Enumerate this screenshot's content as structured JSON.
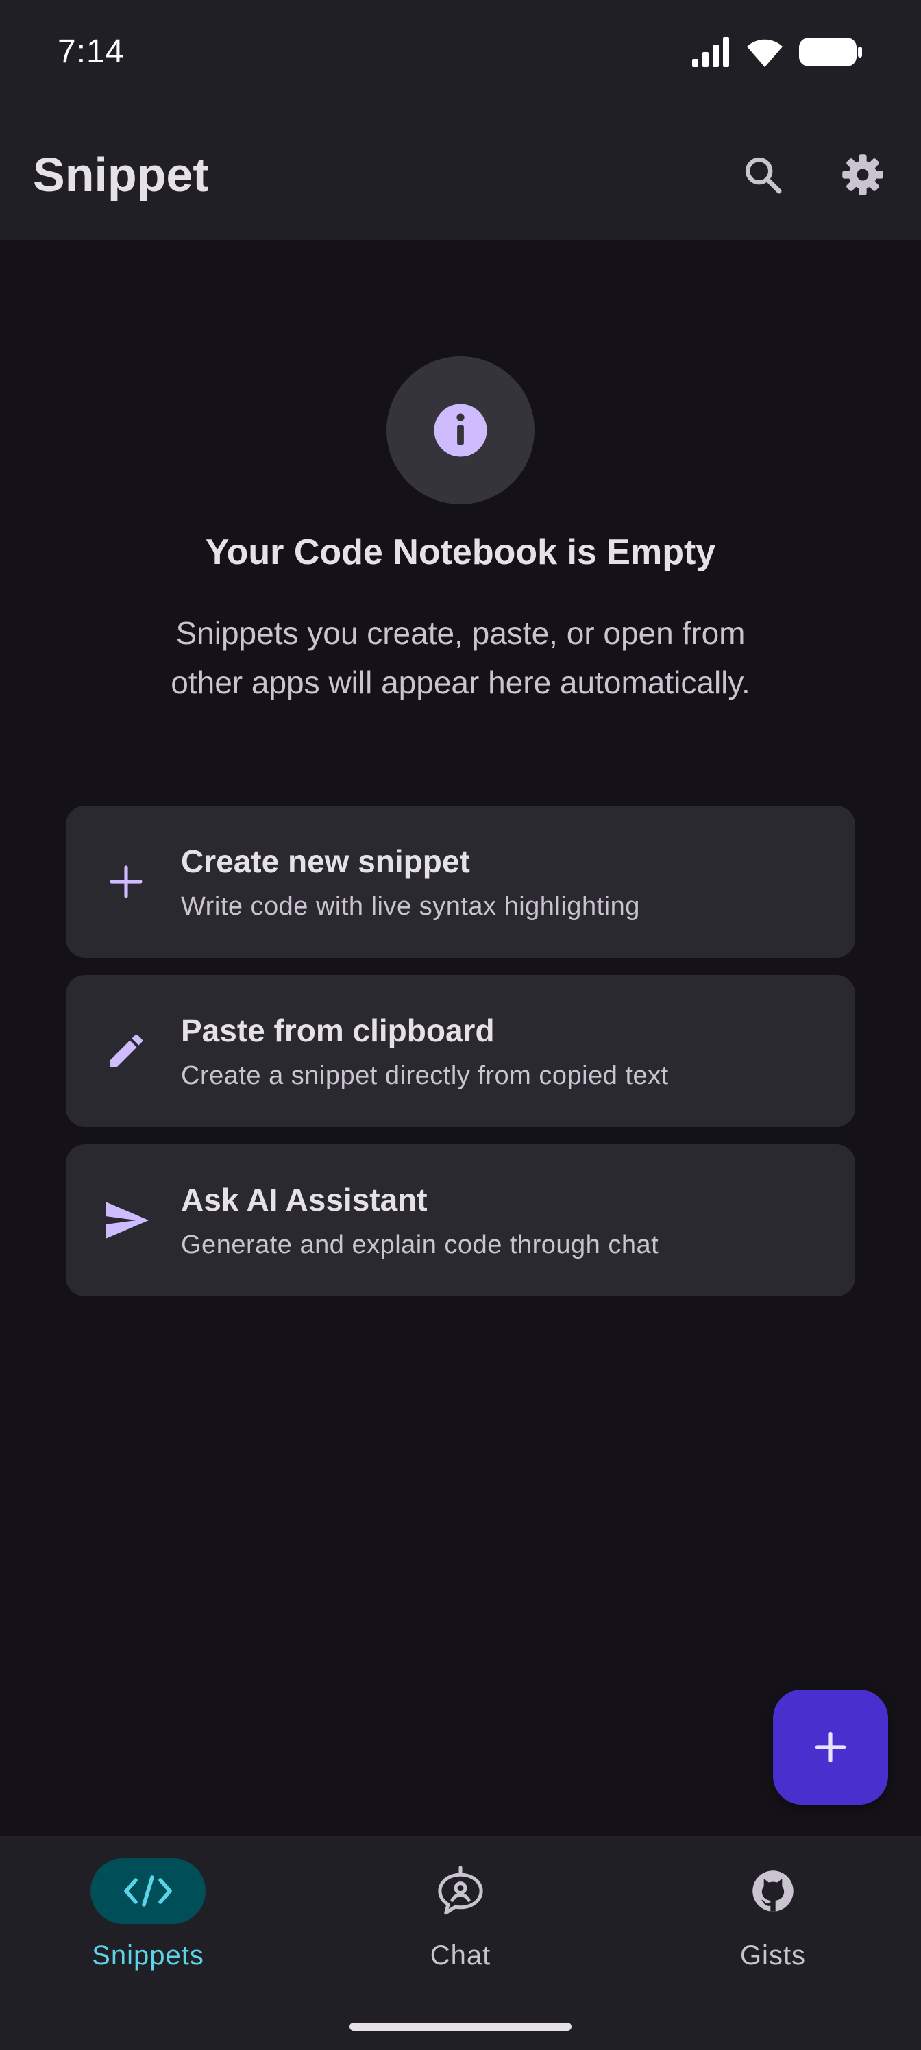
{
  "status_bar": {
    "time": "7:14"
  },
  "app_bar": {
    "title": "Snippet",
    "search_icon": "search-icon",
    "settings_icon": "gear-icon"
  },
  "empty_state": {
    "icon": "info-icon",
    "title": "Your Code Notebook is Empty",
    "body_line1": "Snippets you create, paste, or open from",
    "body_line2": "other apps will appear here automatically."
  },
  "actions": [
    {
      "icon": "plus-icon",
      "title": "Create new snippet",
      "subtitle": "Write code with live syntax highlighting"
    },
    {
      "icon": "pencil-icon",
      "title": "Paste from clipboard",
      "subtitle": "Create a snippet directly from copied text"
    },
    {
      "icon": "send-icon",
      "title": "Ask AI Assistant",
      "subtitle": "Generate and explain code through chat"
    }
  ],
  "fab": {
    "icon": "plus-icon"
  },
  "bottom_nav": {
    "items": [
      {
        "label": "Snippets",
        "icon": "code-icon",
        "active": true
      },
      {
        "label": "Chat",
        "icon": "chat-bot-icon",
        "active": false
      },
      {
        "label": "Gists",
        "icon": "github-icon",
        "active": false
      }
    ]
  },
  "colors": {
    "background": "#141218",
    "surface": "#211F26",
    "card": "#2B2930",
    "accent": "#CFBCFF",
    "fab": "#4A2FCF",
    "nav_active": "#5BD4E6",
    "nav_active_bg": "#004F58"
  }
}
